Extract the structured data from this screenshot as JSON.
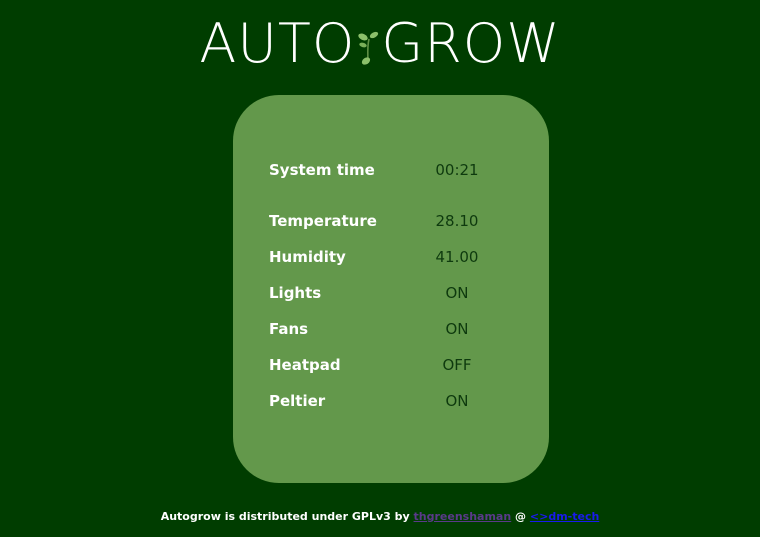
{
  "header": {
    "logo_left": "AUTO",
    "logo_right": "GROW",
    "logo_icon": "sprout-icon"
  },
  "status": {
    "rows": [
      {
        "label": "System time",
        "value": "00:21"
      },
      {
        "label": "Temperature",
        "value": "28.10"
      },
      {
        "label": "Humidity",
        "value": "41.00"
      },
      {
        "label": "Lights",
        "value": "ON"
      },
      {
        "label": "Fans",
        "value": "ON"
      },
      {
        "label": "Heatpad",
        "value": "OFF"
      },
      {
        "label": "Peltier",
        "value": "ON"
      }
    ]
  },
  "footer": {
    "text": "Autogrow is distributed under GPLv3 by",
    "author": "thgreenshaman",
    "at": "@",
    "site": "<>dm-tech"
  },
  "colors": {
    "background": "#003d00",
    "card": "#63984b",
    "label": "#ffffff",
    "value": "#0e3a0e",
    "leaf": "#8bc06a"
  }
}
